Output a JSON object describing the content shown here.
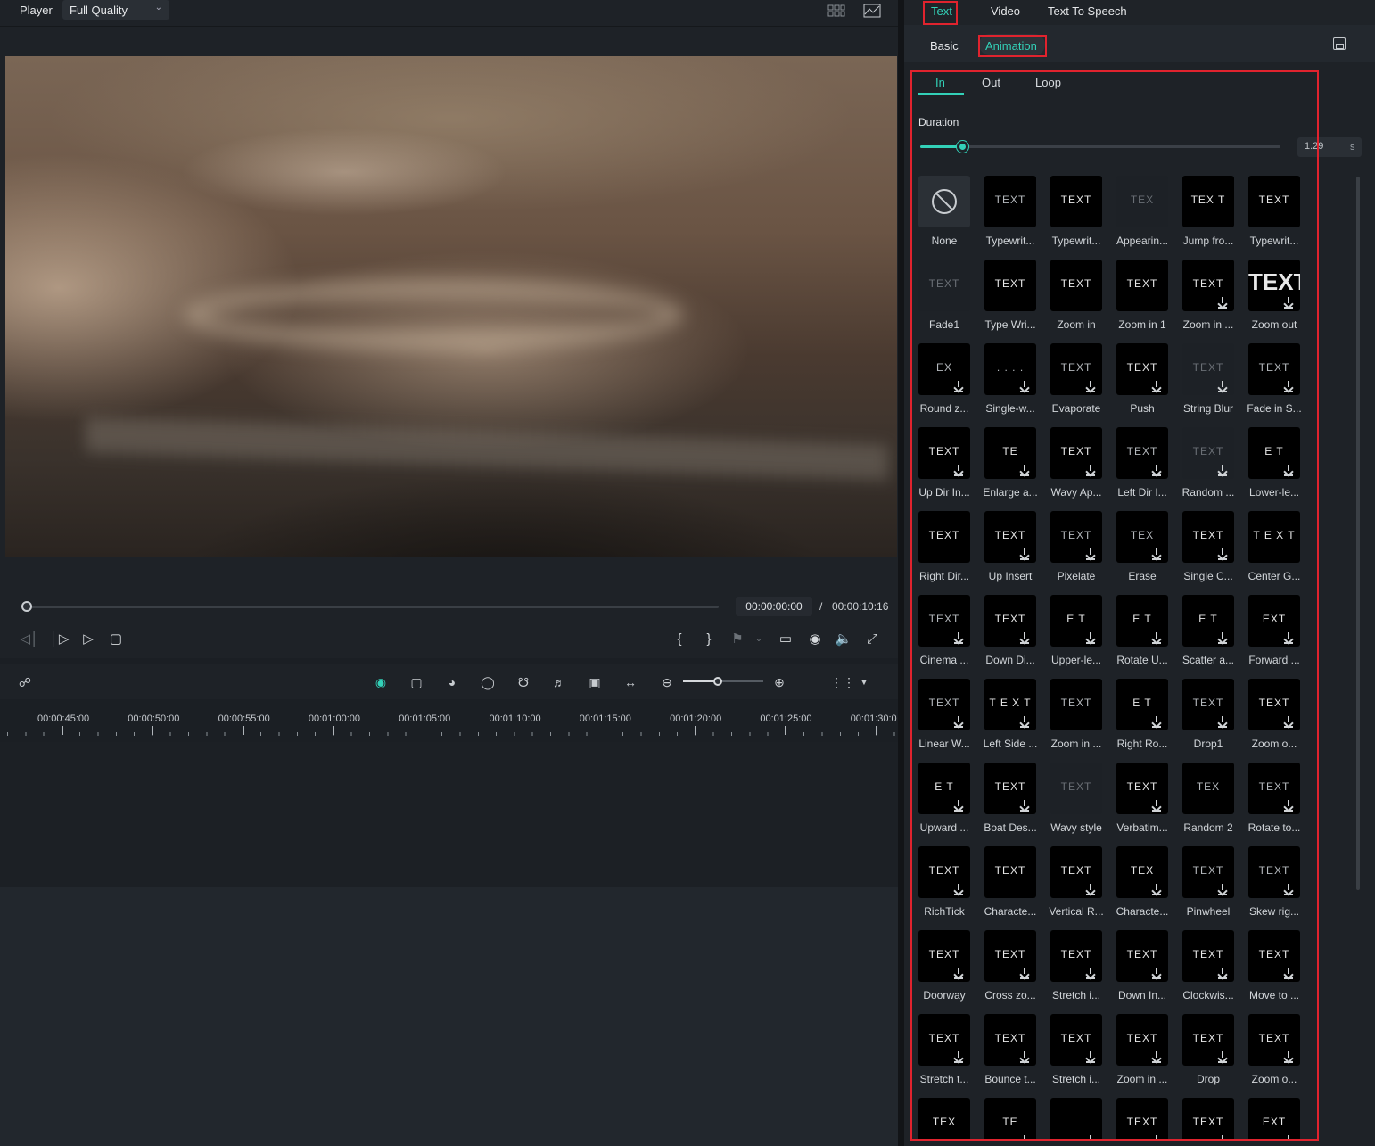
{
  "player": {
    "label": "Player",
    "quality": "Full Quality",
    "timecode_current": "00:00:00:00",
    "timecode_separator": "/",
    "timecode_total": "00:00:10:16"
  },
  "timeline": {
    "ruler_labels": [
      "00:00:45:00",
      "00:00:50:00",
      "00:00:55:00",
      "00:01:00:00",
      "00:01:05:00",
      "00:01:10:00",
      "00:01:15:00",
      "00:01:20:00",
      "00:01:25:00",
      "00:01:30:0"
    ]
  },
  "panel": {
    "tabs": [
      "Text",
      "Video",
      "Text To Speech"
    ],
    "active_tab": "Text",
    "subtabs": [
      "Basic",
      "Animation"
    ],
    "active_subtab": "Animation",
    "anim_tabs": [
      "In",
      "Out",
      "Loop"
    ],
    "active_anim_tab": "In",
    "duration_label": "Duration",
    "duration_value": "1.29",
    "duration_unit": "s",
    "duration_fraction": 0.12,
    "accent_color": "#33d1b8",
    "highlight_color": "#e0232e"
  },
  "presets": [
    {
      "label": "None",
      "thumb": "",
      "style": "none"
    },
    {
      "label": "Typewrit...",
      "thumb": "TEXT",
      "style": "grey"
    },
    {
      "label": "Typewrit...",
      "thumb": "TEXT",
      "style": ""
    },
    {
      "label": "Appearin...",
      "thumb": "TEX",
      "style": "faint"
    },
    {
      "label": "Jump fro...",
      "thumb": "TEX T",
      "style": ""
    },
    {
      "label": "Typewrit...",
      "thumb": "TEXT",
      "style": ""
    },
    {
      "label": "Fade1",
      "thumb": "TEXT",
      "style": "faint"
    },
    {
      "label": "Type Wri...",
      "thumb": "TEXT",
      "style": ""
    },
    {
      "label": "Zoom in",
      "thumb": "TEXT",
      "style": ""
    },
    {
      "label": "Zoom in 1",
      "thumb": "TEXT",
      "style": ""
    },
    {
      "label": "Zoom in ...",
      "thumb": "TEXT",
      "style": "",
      "dl": true
    },
    {
      "label": "Zoom out",
      "thumb": "TEXT",
      "style": "big",
      "dl": true
    },
    {
      "label": "Round z...",
      "thumb": "EX",
      "style": "grey",
      "dl": true
    },
    {
      "label": "Single-w...",
      "thumb": ". . . .",
      "style": "grey",
      "dl": true
    },
    {
      "label": "Evaporate",
      "thumb": "TEXT",
      "style": "grey",
      "dl": true
    },
    {
      "label": "Push",
      "thumb": "TEXT",
      "style": "",
      "dl": true
    },
    {
      "label": "String Blur",
      "thumb": "TEXT",
      "style": "faint",
      "dl": true
    },
    {
      "label": "Fade in S...",
      "thumb": "TEXT",
      "style": "grey",
      "dl": true
    },
    {
      "label": "Up Dir In...",
      "thumb": "TEXT",
      "style": "",
      "dl": true
    },
    {
      "label": "Enlarge a...",
      "thumb": "TE",
      "style": "",
      "dl": true
    },
    {
      "label": "Wavy Ap...",
      "thumb": "TEXT",
      "style": "",
      "dl": true
    },
    {
      "label": "Left Dir I...",
      "thumb": "TEXT",
      "style": "grey",
      "dl": true
    },
    {
      "label": "Random ...",
      "thumb": "TEXT",
      "style": "faint",
      "dl": true
    },
    {
      "label": "Lower-le...",
      "thumb": "E T",
      "style": "",
      "dl": true
    },
    {
      "label": "Right Dir...",
      "thumb": "TEXT",
      "style": ""
    },
    {
      "label": "Up Insert",
      "thumb": "TEXT",
      "style": "",
      "dl": true
    },
    {
      "label": "Pixelate",
      "thumb": "TEXT",
      "style": "grey",
      "dl": true
    },
    {
      "label": "Erase",
      "thumb": "TEX",
      "style": "grey",
      "dl": true
    },
    {
      "label": "Single C...",
      "thumb": "TEXT",
      "style": "",
      "dl": true
    },
    {
      "label": "Center G...",
      "thumb": "T E X T",
      "style": ""
    },
    {
      "label": "Cinema ...",
      "thumb": "TEXT",
      "style": "grey",
      "dl": true
    },
    {
      "label": "Down Di...",
      "thumb": "TEXT",
      "style": "",
      "dl": true
    },
    {
      "label": "Upper-le...",
      "thumb": "E T",
      "style": "",
      "dl": true
    },
    {
      "label": "Rotate U...",
      "thumb": "E T",
      "style": "",
      "dl": true
    },
    {
      "label": "Scatter a...",
      "thumb": "E T",
      "style": "",
      "dl": true
    },
    {
      "label": "Forward ...",
      "thumb": "EXT",
      "style": "",
      "dl": true
    },
    {
      "label": "Linear W...",
      "thumb": "TEXT",
      "style": "grey",
      "dl": true
    },
    {
      "label": "Left Side ...",
      "thumb": "T E X T",
      "style": "",
      "dl": true
    },
    {
      "label": "Zoom in ...",
      "thumb": "TEXT",
      "style": "grey"
    },
    {
      "label": "Right Ro...",
      "thumb": "E T",
      "style": "",
      "dl": true
    },
    {
      "label": "Drop1",
      "thumb": "TEXT",
      "style": "grey",
      "dl": true
    },
    {
      "label": "Zoom o...",
      "thumb": "TEXT",
      "style": "",
      "dl": true
    },
    {
      "label": "Upward ...",
      "thumb": "E T",
      "style": "",
      "dl": true
    },
    {
      "label": "Boat Des...",
      "thumb": "TEXT",
      "style": "",
      "dl": true
    },
    {
      "label": "Wavy style",
      "thumb": "TEXT",
      "style": "faint"
    },
    {
      "label": "Verbatim...",
      "thumb": "TEXT",
      "style": "",
      "dl": true
    },
    {
      "label": "Random 2",
      "thumb": "TEX",
      "style": "grey"
    },
    {
      "label": "Rotate to...",
      "thumb": "TEXT",
      "style": "grey",
      "dl": true
    },
    {
      "label": "RichTick",
      "thumb": "TEXT",
      "style": "",
      "dl": true
    },
    {
      "label": "Characte...",
      "thumb": "TEXT",
      "style": ""
    },
    {
      "label": "Vertical R...",
      "thumb": "TEXT",
      "style": "",
      "dl": true
    },
    {
      "label": "Characte...",
      "thumb": "TEX",
      "style": "",
      "dl": true
    },
    {
      "label": "Pinwheel",
      "thumb": "TEXT",
      "style": "grey",
      "dl": true
    },
    {
      "label": "Skew rig...",
      "thumb": "TEXT",
      "style": "grey",
      "dl": true
    },
    {
      "label": "Doorway",
      "thumb": "TEXT",
      "style": "",
      "dl": true
    },
    {
      "label": "Cross zo...",
      "thumb": "TEXT",
      "style": "",
      "dl": true
    },
    {
      "label": "Stretch i...",
      "thumb": "TEXT",
      "style": "",
      "dl": true
    },
    {
      "label": "Down In...",
      "thumb": "TEXT",
      "style": "",
      "dl": true
    },
    {
      "label": "Clockwis...",
      "thumb": "TEXT",
      "style": "",
      "dl": true
    },
    {
      "label": "Move to ...",
      "thumb": "TEXT",
      "style": "",
      "dl": true
    },
    {
      "label": "Stretch t...",
      "thumb": "TEXT",
      "style": "",
      "dl": true
    },
    {
      "label": "Bounce t...",
      "thumb": "TEXT",
      "style": "",
      "dl": true
    },
    {
      "label": "Stretch i...",
      "thumb": "TEXT",
      "style": "",
      "dl": true
    },
    {
      "label": "Zoom in ...",
      "thumb": "TEXT",
      "style": "",
      "dl": true
    },
    {
      "label": "Drop",
      "thumb": "TEXT",
      "style": "",
      "dl": true
    },
    {
      "label": "Zoom o...",
      "thumb": "TEXT",
      "style": "",
      "dl": true
    },
    {
      "label": "",
      "thumb": "TEX",
      "style": ""
    },
    {
      "label": "",
      "thumb": "TE",
      "style": "",
      "dl": true
    },
    {
      "label": "",
      "thumb": "",
      "style": "",
      "dl": true
    },
    {
      "label": "",
      "thumb": "TEXT",
      "style": "",
      "dl": true
    },
    {
      "label": "",
      "thumb": "TEXT",
      "style": "",
      "dl": true
    },
    {
      "label": "",
      "thumb": "EXT",
      "style": "",
      "dl": true
    }
  ]
}
